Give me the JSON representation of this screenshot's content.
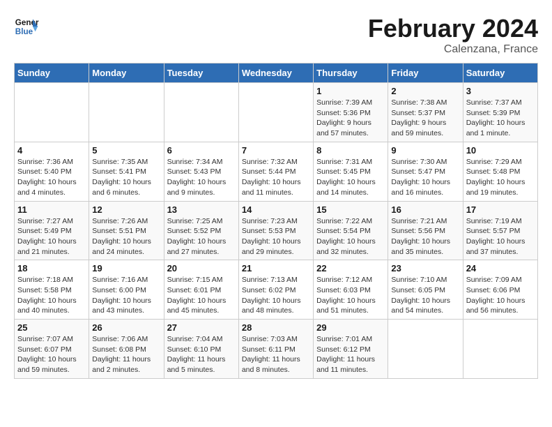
{
  "header": {
    "logo_general": "General",
    "logo_blue": "Blue",
    "title": "February 2024",
    "subtitle": "Calenzana, France"
  },
  "weekdays": [
    "Sunday",
    "Monday",
    "Tuesday",
    "Wednesday",
    "Thursday",
    "Friday",
    "Saturday"
  ],
  "weeks": [
    {
      "days": [
        {
          "number": "",
          "info": ""
        },
        {
          "number": "",
          "info": ""
        },
        {
          "number": "",
          "info": ""
        },
        {
          "number": "",
          "info": ""
        },
        {
          "number": "1",
          "info": "Sunrise: 7:39 AM\nSunset: 5:36 PM\nDaylight: 9 hours\nand 57 minutes."
        },
        {
          "number": "2",
          "info": "Sunrise: 7:38 AM\nSunset: 5:37 PM\nDaylight: 9 hours\nand 59 minutes."
        },
        {
          "number": "3",
          "info": "Sunrise: 7:37 AM\nSunset: 5:39 PM\nDaylight: 10 hours\nand 1 minute."
        }
      ]
    },
    {
      "days": [
        {
          "number": "4",
          "info": "Sunrise: 7:36 AM\nSunset: 5:40 PM\nDaylight: 10 hours\nand 4 minutes."
        },
        {
          "number": "5",
          "info": "Sunrise: 7:35 AM\nSunset: 5:41 PM\nDaylight: 10 hours\nand 6 minutes."
        },
        {
          "number": "6",
          "info": "Sunrise: 7:34 AM\nSunset: 5:43 PM\nDaylight: 10 hours\nand 9 minutes."
        },
        {
          "number": "7",
          "info": "Sunrise: 7:32 AM\nSunset: 5:44 PM\nDaylight: 10 hours\nand 11 minutes."
        },
        {
          "number": "8",
          "info": "Sunrise: 7:31 AM\nSunset: 5:45 PM\nDaylight: 10 hours\nand 14 minutes."
        },
        {
          "number": "9",
          "info": "Sunrise: 7:30 AM\nSunset: 5:47 PM\nDaylight: 10 hours\nand 16 minutes."
        },
        {
          "number": "10",
          "info": "Sunrise: 7:29 AM\nSunset: 5:48 PM\nDaylight: 10 hours\nand 19 minutes."
        }
      ]
    },
    {
      "days": [
        {
          "number": "11",
          "info": "Sunrise: 7:27 AM\nSunset: 5:49 PM\nDaylight: 10 hours\nand 21 minutes."
        },
        {
          "number": "12",
          "info": "Sunrise: 7:26 AM\nSunset: 5:51 PM\nDaylight: 10 hours\nand 24 minutes."
        },
        {
          "number": "13",
          "info": "Sunrise: 7:25 AM\nSunset: 5:52 PM\nDaylight: 10 hours\nand 27 minutes."
        },
        {
          "number": "14",
          "info": "Sunrise: 7:23 AM\nSunset: 5:53 PM\nDaylight: 10 hours\nand 29 minutes."
        },
        {
          "number": "15",
          "info": "Sunrise: 7:22 AM\nSunset: 5:54 PM\nDaylight: 10 hours\nand 32 minutes."
        },
        {
          "number": "16",
          "info": "Sunrise: 7:21 AM\nSunset: 5:56 PM\nDaylight: 10 hours\nand 35 minutes."
        },
        {
          "number": "17",
          "info": "Sunrise: 7:19 AM\nSunset: 5:57 PM\nDaylight: 10 hours\nand 37 minutes."
        }
      ]
    },
    {
      "days": [
        {
          "number": "18",
          "info": "Sunrise: 7:18 AM\nSunset: 5:58 PM\nDaylight: 10 hours\nand 40 minutes."
        },
        {
          "number": "19",
          "info": "Sunrise: 7:16 AM\nSunset: 6:00 PM\nDaylight: 10 hours\nand 43 minutes."
        },
        {
          "number": "20",
          "info": "Sunrise: 7:15 AM\nSunset: 6:01 PM\nDaylight: 10 hours\nand 45 minutes."
        },
        {
          "number": "21",
          "info": "Sunrise: 7:13 AM\nSunset: 6:02 PM\nDaylight: 10 hours\nand 48 minutes."
        },
        {
          "number": "22",
          "info": "Sunrise: 7:12 AM\nSunset: 6:03 PM\nDaylight: 10 hours\nand 51 minutes."
        },
        {
          "number": "23",
          "info": "Sunrise: 7:10 AM\nSunset: 6:05 PM\nDaylight: 10 hours\nand 54 minutes."
        },
        {
          "number": "24",
          "info": "Sunrise: 7:09 AM\nSunset: 6:06 PM\nDaylight: 10 hours\nand 56 minutes."
        }
      ]
    },
    {
      "days": [
        {
          "number": "25",
          "info": "Sunrise: 7:07 AM\nSunset: 6:07 PM\nDaylight: 10 hours\nand 59 minutes."
        },
        {
          "number": "26",
          "info": "Sunrise: 7:06 AM\nSunset: 6:08 PM\nDaylight: 11 hours\nand 2 minutes."
        },
        {
          "number": "27",
          "info": "Sunrise: 7:04 AM\nSunset: 6:10 PM\nDaylight: 11 hours\nand 5 minutes."
        },
        {
          "number": "28",
          "info": "Sunrise: 7:03 AM\nSunset: 6:11 PM\nDaylight: 11 hours\nand 8 minutes."
        },
        {
          "number": "29",
          "info": "Sunrise: 7:01 AM\nSunset: 6:12 PM\nDaylight: 11 hours\nand 11 minutes."
        },
        {
          "number": "",
          "info": ""
        },
        {
          "number": "",
          "info": ""
        }
      ]
    }
  ]
}
